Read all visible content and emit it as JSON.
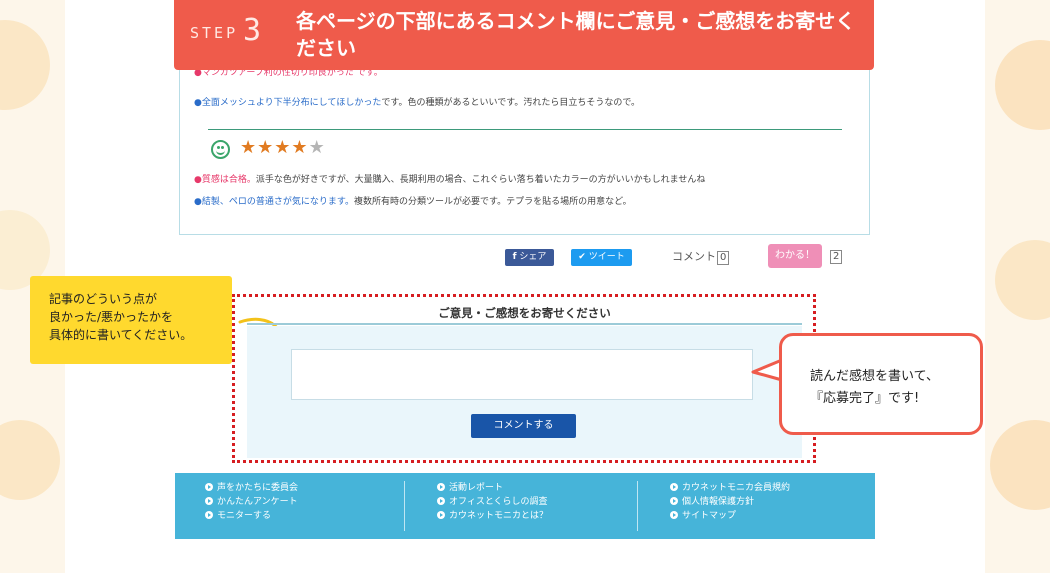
{
  "step": {
    "word": "STEP",
    "number": "3",
    "title": "各ページの下部にあるコメント欄にご意見・ご感想をお寄せください"
  },
  "review": {
    "clipped_line": "●マンガツアーブ利の性切り印良かった です。",
    "line1_highlight": "●全面メッシュより下半分布にしてほしかった",
    "line1_rest": "です。色の種類があるといいです。汚れたら目立ちそうなので。",
    "rating_stars_filled": 4,
    "rating_stars_total": 5,
    "line2_highlight": "●質感は合格。",
    "line2_rest": "派手な色が好きですが、大量購入、長期利用の場合、これぐらい落ち着いたカラーの方がいいかもしれませんね",
    "line3_highlight": "●結製、ペロの普通さが気になります。",
    "line3_rest": "複数所有時の分類ツールが必要です。テプラを貼る場所の用意など。"
  },
  "share": {
    "facebook_label": "シェア",
    "twitter_label": "ツイート",
    "comment_label": "コメント",
    "comment_count": "0",
    "wakaru_label": "わかる！",
    "wakaru_count": "2"
  },
  "note": {
    "text": "記事のどういう点が\n良かった/悪かったかを\n具体的に書いてください。"
  },
  "form": {
    "title": "ご意見・ご感想をお寄せください",
    "input_value": "",
    "submit_label": "コメントする"
  },
  "bubble": {
    "text": "読んだ感想を書いて、\n『応募完了』です!"
  },
  "footer": {
    "col1": [
      "声をかたちに委員会",
      "かんたんアンケート",
      "モニターする"
    ],
    "col2": [
      "活動レポート",
      "オフィスとくらしの調査",
      "カウネットモニカとは？"
    ],
    "col3": [
      "カウネットモニカ会員規約",
      "個人情報保護方針",
      "サイトマップ"
    ]
  },
  "colors": {
    "banner": "#ef5b4b",
    "note": "#ffd92e",
    "frame": "#d61d21",
    "footer": "#46b4d9",
    "submit": "#1955a8"
  }
}
